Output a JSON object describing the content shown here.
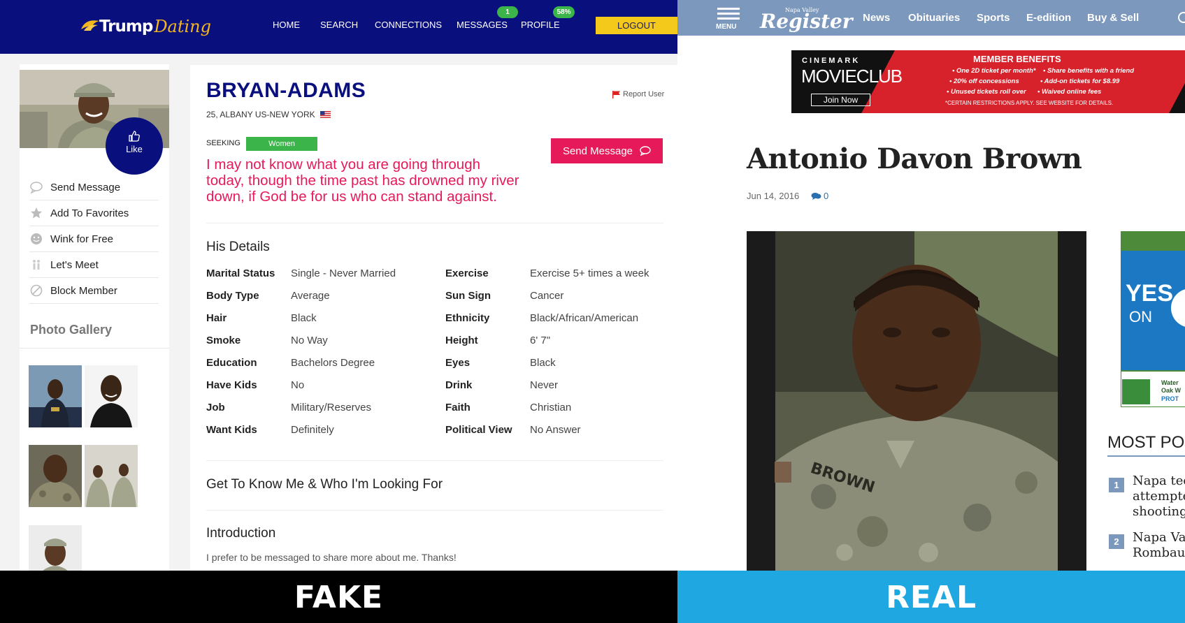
{
  "fake_site": {
    "logo": {
      "part1": "Trump",
      "part2": "Dating"
    },
    "nav": [
      {
        "label": "HOME"
      },
      {
        "label": "SEARCH"
      },
      {
        "label": "CONNECTIONS"
      },
      {
        "label": "MESSAGES",
        "badge": "1"
      },
      {
        "label": "PROFILE",
        "badge": "58%"
      }
    ],
    "logout_label": "LOGOUT",
    "like_label": "Like",
    "sidebar_menu": [
      {
        "label": "Send Message",
        "icon": "chat-bubble-icon"
      },
      {
        "label": "Add To Favorites",
        "icon": "star-icon"
      },
      {
        "label": "Wink for Free",
        "icon": "smiley-icon"
      },
      {
        "label": "Let's Meet",
        "icon": "couple-icon"
      },
      {
        "label": "Block Member",
        "icon": "block-icon"
      }
    ],
    "gallery_title": "Photo Gallery",
    "profile": {
      "name": "BRYAN-ADAMS",
      "location": "25, ALBANY US-NEW YORK",
      "report_label": "Report User",
      "seeking_label": "SEEKING",
      "seeking_value": "Women",
      "send_message_label": "Send Message",
      "quote": "I may not know what you are going through today, though the time past has drowned my river down, if God be for us who can stand against."
    },
    "details_title": "His Details",
    "details_left": [
      {
        "label": "Marital Status",
        "value": "Single - Never Married"
      },
      {
        "label": "Body Type",
        "value": "Average"
      },
      {
        "label": "Hair",
        "value": "Black"
      },
      {
        "label": "Smoke",
        "value": "No Way"
      },
      {
        "label": "Education",
        "value": "Bachelors Degree"
      },
      {
        "label": "Have Kids",
        "value": "No"
      },
      {
        "label": "Job",
        "value": "Military/Reserves"
      },
      {
        "label": "Want Kids",
        "value": "Definitely"
      }
    ],
    "details_right": [
      {
        "label": "Exercise",
        "value": "Exercise 5+ times a week"
      },
      {
        "label": "Sun Sign",
        "value": "Cancer"
      },
      {
        "label": "Ethnicity",
        "value": "Black/African/American"
      },
      {
        "label": "Height",
        "value": "6' 7\""
      },
      {
        "label": "Eyes",
        "value": "Black"
      },
      {
        "label": "Drink",
        "value": "Never"
      },
      {
        "label": "Faith",
        "value": "Christian"
      },
      {
        "label": "Political View",
        "value": "No Answer"
      }
    ],
    "get_to_know_title": "Get To Know Me & Who I'm Looking For",
    "intro_title": "Introduction",
    "intro_text": "I prefer to be messaged to share more about me. Thanks!"
  },
  "real_site": {
    "menu_label": "MENU",
    "logo_small": "Napa Valley",
    "logo_big": "Register",
    "nav": [
      {
        "label": "News"
      },
      {
        "label": "Obituaries"
      },
      {
        "label": "Sports"
      },
      {
        "label": "E-edition"
      },
      {
        "label": "Buy & Sell"
      }
    ],
    "ad": {
      "brand_top": "CINEMARK",
      "brand_main": "MOVIECLUB",
      "join": "Join Now",
      "benefits_title": "MEMBER BENEFITS",
      "benefits": [
        "• One 2D ticket per month*",
        "• Share benefits with a friend",
        "• 20% off concessions",
        "• Add-on tickets for $8.99",
        "• Unused tickets roll over",
        "• Waived online fees"
      ],
      "footnote": "*CERTAIN RESTRICTIONS APPLY. SEE WEBSITE FOR DETAILS."
    },
    "headline": "Antonio Davon Brown",
    "date": "Jun 14, 2016",
    "comments": "0",
    "side_ad": {
      "line1": "YES",
      "line2": "ON",
      "line3": "Water",
      "line4": "Oak W",
      "line5": "PROT"
    },
    "most_popular_title": "MOST POP",
    "most_popular": [
      {
        "num": "1",
        "text": "Napa teen\nattempte\nshooting"
      },
      {
        "num": "2",
        "text": "Napa Vall\nRombaue"
      }
    ]
  },
  "banners": {
    "fake": "FAKE",
    "real": "REAL"
  },
  "colors": {
    "navy": "#0a0f7e",
    "pink": "#e6195a",
    "green": "#3bb54a",
    "gold": "#f5c91b",
    "register_blue": "#7c98bc",
    "real_banner": "#1ea7e0"
  }
}
